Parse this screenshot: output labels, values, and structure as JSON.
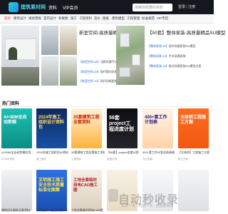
{
  "header": {
    "brand": "建筑素材网",
    "links": [
      "资料",
      "VIP会员"
    ],
    "search_placeholder": "搜索你想要的资料",
    "login": "登录 | 注册"
  },
  "nav": {
    "items": [
      "首页",
      "建筑设计",
      "规划景观",
      "室内设计",
      "效果图",
      "施工",
      "工程资料",
      "造价",
      "图纸",
      "建筑模型",
      "工程管理",
      "标准规范",
      "VIP专区"
    ]
  },
  "featured": {
    "left": {
      "title": "新室空间-高质量精品SU模型",
      "lines": [
        {
          "tag": "【新室空间-68】",
          "text": "北欧风客厅SU模型"
        },
        {
          "tag": "【新室空间-69】",
          "text": "现代简约风卧室…SU模型+渲染"
        },
        {
          "tag": "【新室空间-70】",
          "text": "现代风格厨房SU模型+渲染"
        }
      ]
    },
    "right": {
      "title": "【50套】整体家装-高质量精品SU模型",
      "lines": [
        {
          "tag": "【整体家装-50】",
          "text": "现代风格家装SU模型"
        },
        {
          "tag": "【整体家装-49】",
          "text": "中式风格家装"
        },
        {
          "tag": "【整体家装-48】",
          "text": "欧式风格家装SU模型方案"
        }
      ]
    }
  },
  "section": {
    "title": "热门资料"
  },
  "posters": [
    {
      "text": "AI+BIM全自动剪辑",
      "caption": "AI+BIM全自动剪辑应用…",
      "sub": "AI+BIM资料"
    },
    {
      "text": "2024年施工组织设计资料包",
      "caption": "2024年施工组织设计资料",
      "sub": "施工组织"
    },
    {
      "text": "35套建筑工程全套资料",
      "caption": "35套建筑工程全套施工资料",
      "sub": "工程资料"
    },
    {
      "text": "56套project工程进度计划",
      "caption": "【56套】project进度计划",
      "sub": "进度计划"
    },
    {
      "text": "400+套工作计划表",
      "caption": "400+套工作计划总结表格",
      "sub": "办公表格"
    },
    {
      "text": "大体积工程施工方案",
      "caption": "【大体积】工程施工方案",
      "sub": "施工方案"
    }
  ],
  "row3": [
    {
      "text": "",
      "caption": "建筑设计图纸全套资料",
      "sub": "建筑设计"
    },
    {
      "text": "文明施工施工安全技术质量标准化图集",
      "caption": "文明施工、施工安全技术…",
      "sub": "施工安全"
    },
    {
      "text": "工地全套临时用电CAD施工图",
      "caption": "工地全套临时用电CAD图",
      "sub": "施工图"
    },
    {
      "text": "",
      "caption": "",
      "sub": ""
    },
    {
      "text": "",
      "caption": "",
      "sub": ""
    },
    {
      "text": "",
      "caption": "",
      "sub": ""
    }
  ],
  "watermark": {
    "title": "自动秒收录",
    "sub": "收录一天 · 稳定一次 · 自动秒收录"
  }
}
